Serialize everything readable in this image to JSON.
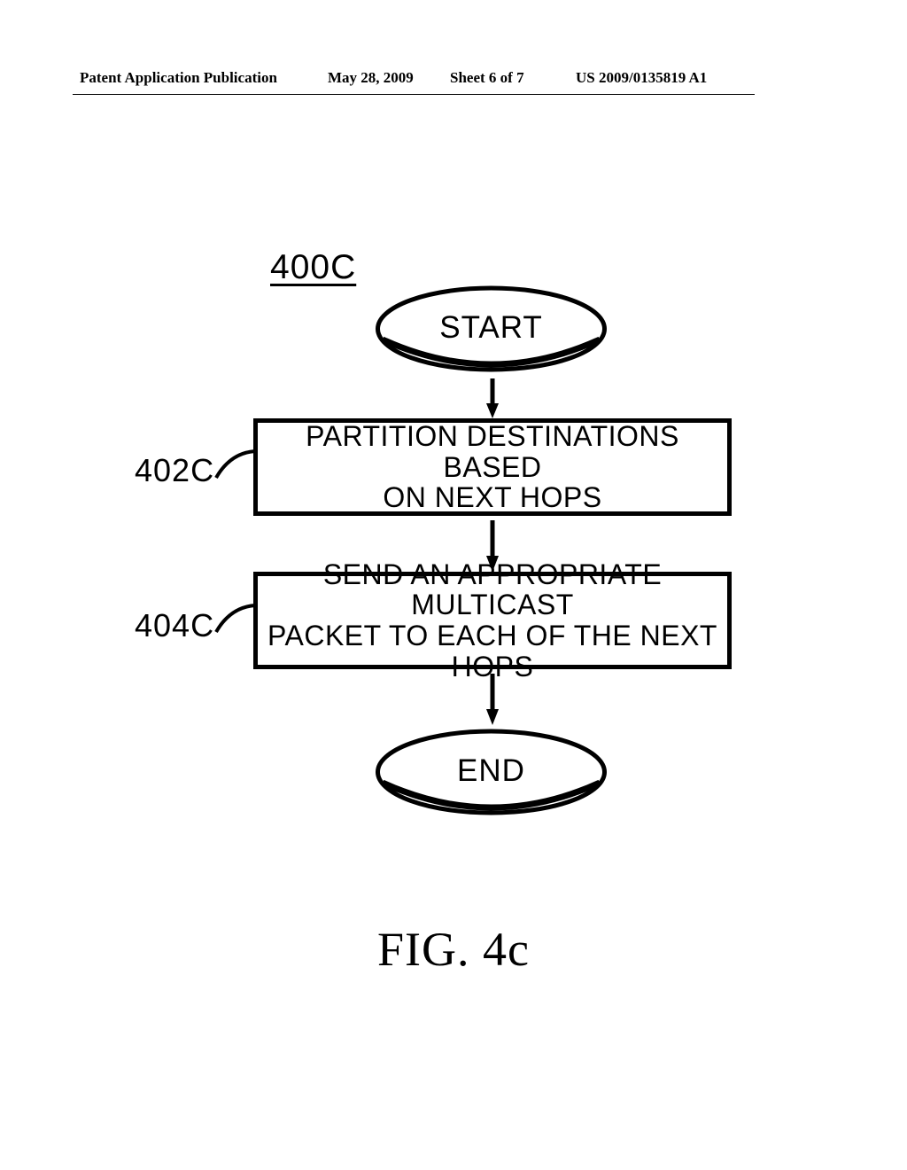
{
  "header": {
    "left": "Patent Application Publication",
    "date": "May 28, 2009",
    "sheet": "Sheet 6 of 7",
    "pubno": "US 2009/0135819 A1"
  },
  "diagram": {
    "fig_ref": "400C",
    "start": "START",
    "end": "END",
    "steps": [
      {
        "ref": "402C",
        "text_line1": "PARTITION DESTINATIONS BASED",
        "text_line2": "ON NEXT HOPS"
      },
      {
        "ref": "404C",
        "text_line1": "SEND AN APPROPRIATE MULTICAST",
        "text_line2": "PACKET TO EACH OF THE NEXT HOPS"
      }
    ]
  },
  "caption": "FIG. 4c",
  "chart_data": {
    "type": "flowchart",
    "title": "FIG. 4c",
    "figure_ref": "400C",
    "nodes": [
      {
        "id": "start",
        "shape": "terminator",
        "label": "START"
      },
      {
        "id": "402C",
        "shape": "process",
        "label": "PARTITION DESTINATIONS BASED ON NEXT HOPS"
      },
      {
        "id": "404C",
        "shape": "process",
        "label": "SEND AN APPROPRIATE MULTICAST PACKET TO EACH OF THE NEXT HOPS"
      },
      {
        "id": "end",
        "shape": "terminator",
        "label": "END"
      }
    ],
    "edges": [
      {
        "from": "start",
        "to": "402C"
      },
      {
        "from": "402C",
        "to": "404C"
      },
      {
        "from": "404C",
        "to": "end"
      }
    ]
  }
}
